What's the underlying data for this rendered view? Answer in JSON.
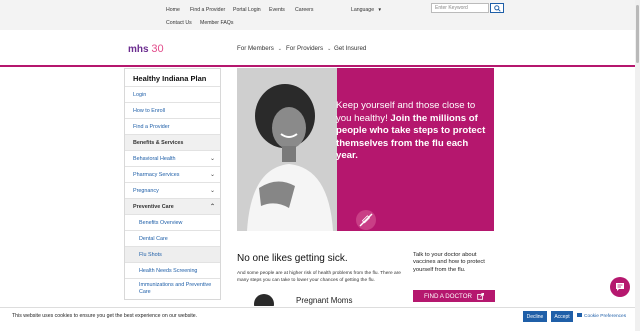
{
  "utility_nav": {
    "links": [
      "Home",
      "Find a Provider",
      "Portal Login",
      "Events",
      "Careers",
      "Contact Us",
      "Member FAQs"
    ],
    "language_label": "Language",
    "search_placeholder": "Enter Keyword"
  },
  "header": {
    "logo_text": "mhs",
    "logo_badge": "30",
    "nav": [
      "For Members",
      "For Providers",
      "Get Insured"
    ]
  },
  "sidebar": {
    "title": "Healthy Indiana Plan",
    "items": [
      {
        "label": "Login"
      },
      {
        "label": "How to Enroll"
      },
      {
        "label": "Find a Provider"
      },
      {
        "label": "Benefits & Services"
      },
      {
        "label": "Behavioral Health"
      },
      {
        "label": "Pharmacy Services"
      },
      {
        "label": "Pregnancy"
      },
      {
        "label": "Preventive Care"
      },
      {
        "label": "Benefits Overview"
      },
      {
        "label": "Dental Care"
      },
      {
        "label": "Flu Shots"
      },
      {
        "label": "Health Needs Screening"
      },
      {
        "label": "Immunizations and Preventive Care"
      }
    ]
  },
  "hero": {
    "text_plain": "Keep yourself and those close to you healthy! ",
    "text_bold": "Join the millions of people who take steps to protect themselves from the flu each year."
  },
  "content": {
    "heading": "No one likes getting sick.",
    "paragraph": "And some people are at higher risk of health problems from the flu. There are many steps you can take to lower your chances of getting the flu.",
    "subheading": "Pregnant Moms",
    "talk_text": "Talk to your doctor about vaccines and how to protect yourself from the flu.",
    "find_button": "FIND A DOCTOR"
  },
  "cookie": {
    "message": "This website uses cookies to ensure you get the best experience on our website.",
    "decline": "Decline",
    "accept": "Accept",
    "preferences": "Cookie Preferences"
  },
  "colors": {
    "brand_magenta": "#b5176e",
    "link_blue": "#1f5fa8"
  }
}
